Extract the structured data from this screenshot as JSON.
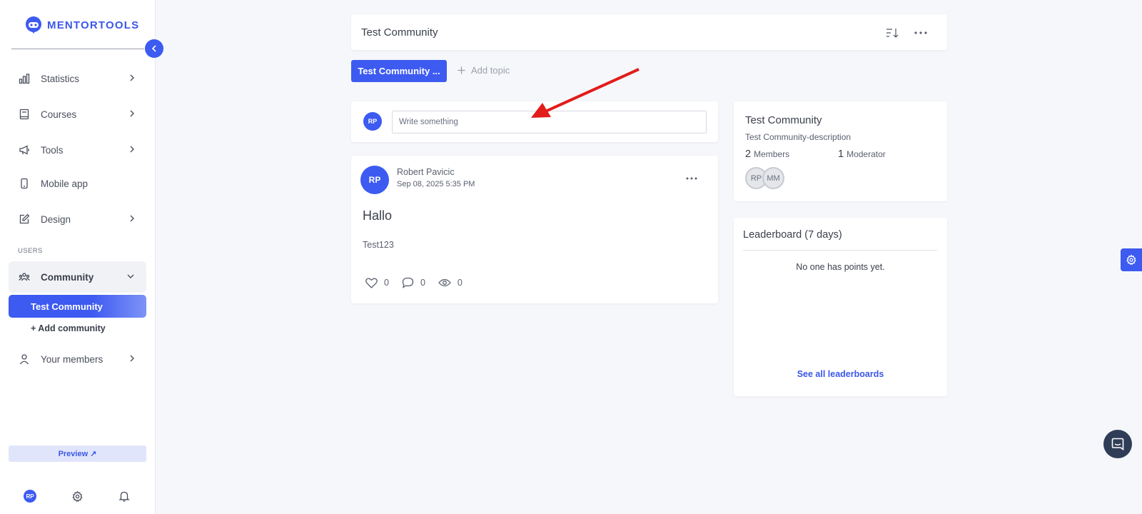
{
  "brand": {
    "name": "MENTORTOOLS",
    "accent": "#3d5af1"
  },
  "sidebar": {
    "items": [
      {
        "label": "Statistics",
        "icon": "bar-chart-icon"
      },
      {
        "label": "Courses",
        "icon": "book-icon"
      },
      {
        "label": "Tools",
        "icon": "megaphone-icon"
      },
      {
        "label": "Mobile app",
        "icon": "phone-icon"
      },
      {
        "label": "Design",
        "icon": "pencil-icon"
      }
    ],
    "section_label": "USERS",
    "community": {
      "label": "Community",
      "icon": "users-icon"
    },
    "active_sub": "Test Community",
    "add_community": "+ Add community",
    "members": {
      "label": "Your members",
      "icon": "user-icon"
    },
    "preview": "Preview ↗",
    "user_initials": "RP"
  },
  "header": {
    "title": "Test Community"
  },
  "topics": {
    "active": "Test Community ...",
    "add": "Add topic"
  },
  "composer": {
    "initials": "RP",
    "placeholder": "Write something"
  },
  "post": {
    "initials": "RP",
    "author": "Robert Pavicic",
    "date": "Sep 08, 2025 5:35 PM",
    "title": "Hallo",
    "body": "Test123",
    "likes": "0",
    "comments": "0",
    "views": "0"
  },
  "info": {
    "title": "Test Community",
    "description": "Test Community-description",
    "members_count": "2",
    "members_label": "Members",
    "moderators_count": "1",
    "moderators_label": "Moderator",
    "member_avatars": [
      "RP",
      "MM"
    ]
  },
  "leaderboard": {
    "title": "Leaderboard (7 days)",
    "empty": "No one has points yet.",
    "link": "See all leaderboards"
  }
}
